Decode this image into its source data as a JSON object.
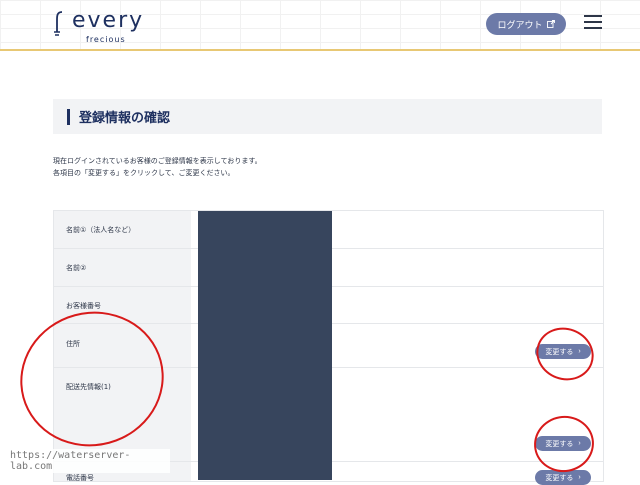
{
  "header": {
    "logo_word": "every",
    "logo_sub": "frecious",
    "logout_label": "ログアウト",
    "logout_icon": "external-link-icon",
    "menu_icon": "hamburger-menu-icon"
  },
  "section": {
    "title": "登録情報の確認",
    "desc_line1": "現在ログインされているお客様のご登録情報を表示しております。",
    "desc_line2": "各項目の「変更する」をクリックして、ご変更ください。"
  },
  "table": {
    "rows": [
      {
        "label": "名前①（法人名など）"
      },
      {
        "label": "名前②"
      },
      {
        "label": "お客様番号"
      },
      {
        "label": "住所"
      },
      {
        "label": "配送先情報(1)"
      },
      {
        "label": "電話番号"
      }
    ],
    "change_label": "変更する"
  },
  "watermark": "https://waterserver-lab.com",
  "colors": {
    "accent": "#6c7aa8",
    "navy": "#1e3060",
    "redaction": "#37455d",
    "annotation_red": "#d81a1a",
    "header_border": "#e8c874"
  }
}
